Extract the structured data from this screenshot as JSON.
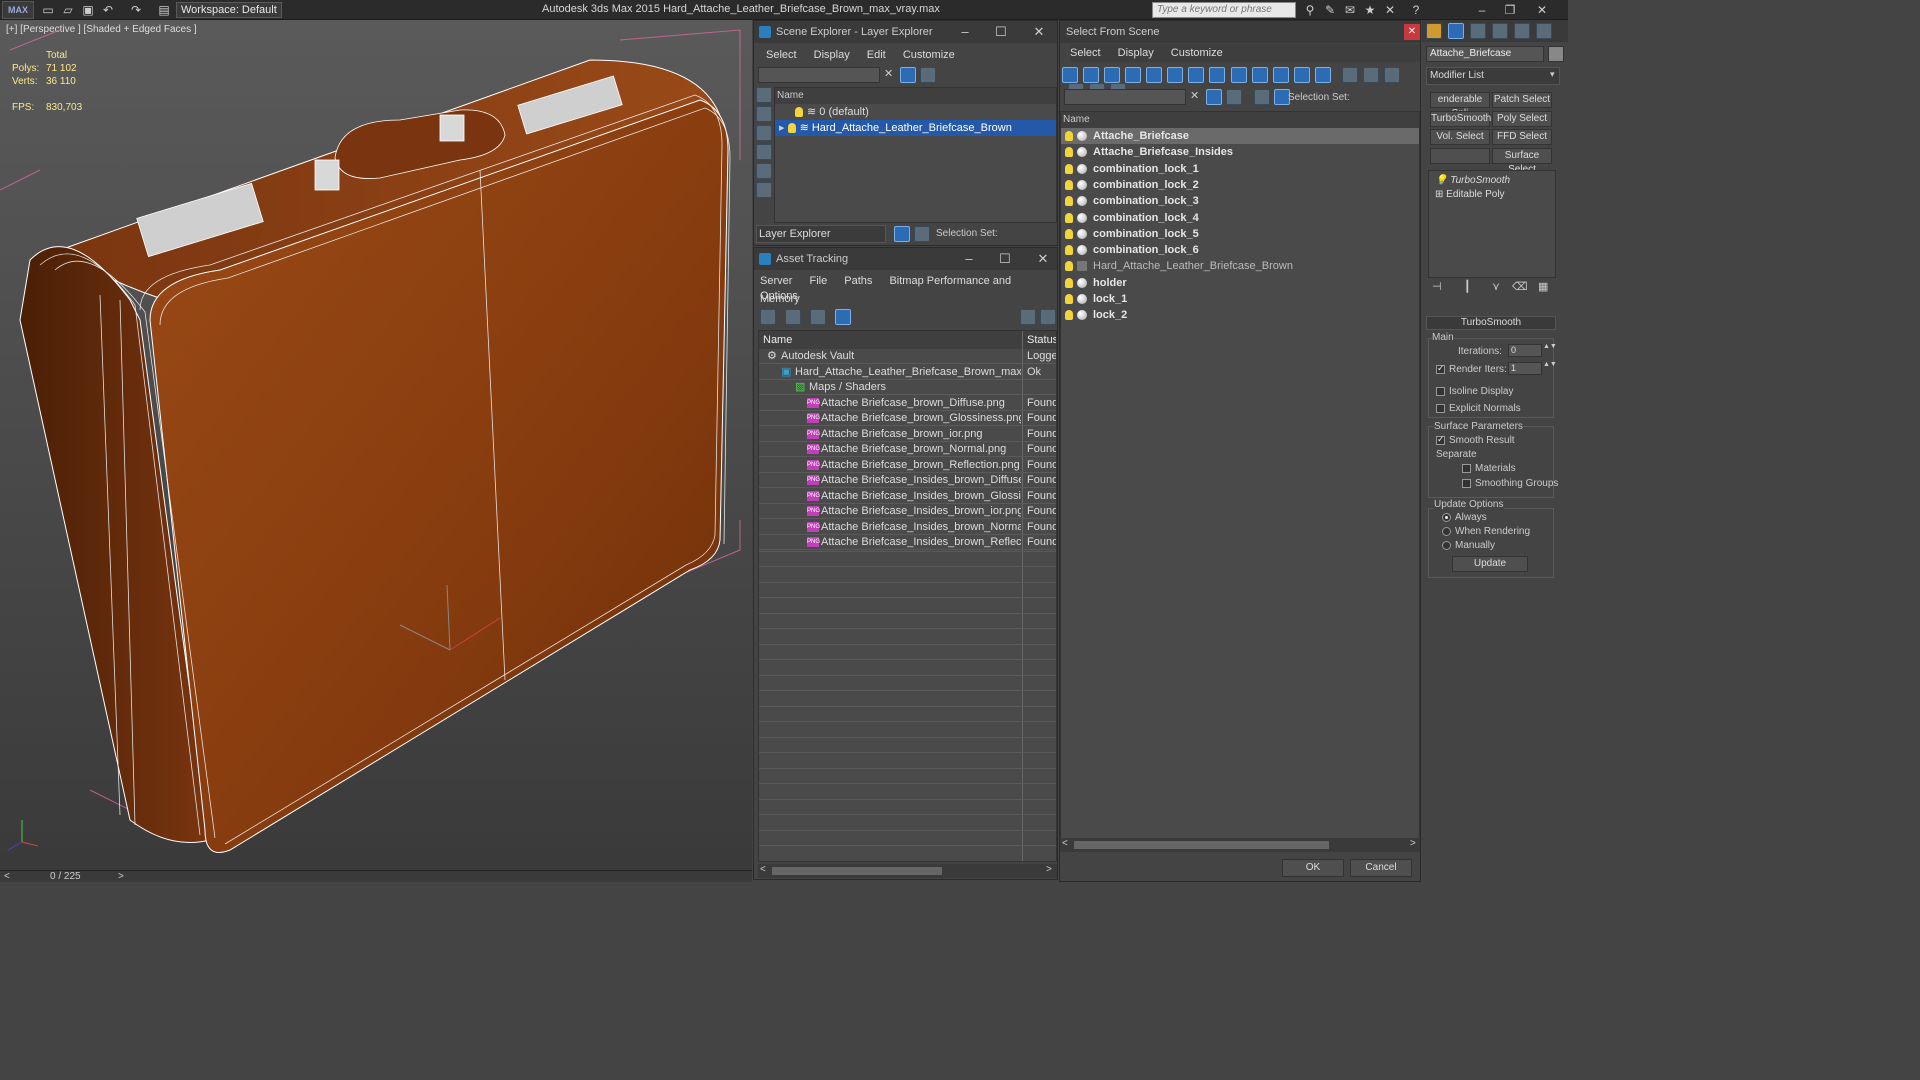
{
  "app": {
    "logo": "MAX",
    "workspace": "Workspace: Default",
    "title": "Autodesk 3ds Max 2015     Hard_Attache_Leather_Briefcase_Brown_max_vray.max",
    "search_placeholder": "Type a keyword or phrase"
  },
  "viewport": {
    "label": "[+] [Perspective ] [Shaded + Edged Faces ]",
    "stats_total": "Total",
    "polys_label": "Polys:",
    "polys_value": "71 102",
    "verts_label": "Verts:",
    "verts_value": "36 110",
    "fps_label": "FPS:",
    "fps_value": "830,703",
    "timeline": "0 / 225"
  },
  "scene_explorer": {
    "title": "Scene Explorer - Layer Explorer",
    "menu": [
      "Select",
      "Display",
      "Edit",
      "Customize"
    ],
    "col_name": "Name",
    "rows": [
      "0 (default)",
      "Hard_Attache_Leather_Briefcase_Brown"
    ],
    "footer_combo": "Layer Explorer",
    "selection_set": "Selection Set:"
  },
  "asset_tracking": {
    "title": "Asset Tracking",
    "menu": [
      "Server",
      "File",
      "Paths",
      "Bitmap Performance and Memory",
      "Options"
    ],
    "col_name": "Name",
    "col_status": "Status",
    "rows": [
      {
        "name": "Autodesk Vault",
        "status": "Logged"
      },
      {
        "name": "Hard_Attache_Leather_Briefcase_Brown_max_vr...",
        "status": "Ok"
      },
      {
        "name": "Maps / Shaders",
        "status": ""
      },
      {
        "name": "Attache Briefcase_brown_Diffuse.png",
        "status": "Found"
      },
      {
        "name": "Attache Briefcase_brown_Glossiness.png",
        "status": "Found"
      },
      {
        "name": "Attache Briefcase_brown_ior.png",
        "status": "Found"
      },
      {
        "name": "Attache Briefcase_brown_Normal.png",
        "status": "Found"
      },
      {
        "name": "Attache Briefcase_brown_Reflection.png",
        "status": "Found"
      },
      {
        "name": "Attache Briefcase_Insides_brown_Diffuse....",
        "status": "Found"
      },
      {
        "name": "Attache Briefcase_Insides_brown_Glossine...",
        "status": "Found"
      },
      {
        "name": "Attache Briefcase_Insides_brown_ior.png",
        "status": "Found"
      },
      {
        "name": "Attache Briefcase_Insides_brown_Normal....",
        "status": "Found"
      },
      {
        "name": "Attache Briefcase_Insides_brown_Reflectio...",
        "status": "Found"
      }
    ]
  },
  "select_from_scene": {
    "title": "Select From Scene",
    "menu": [
      "Select",
      "Display",
      "Customize"
    ],
    "selection_set": "Selection Set:",
    "col_name": "Name",
    "objects": [
      "Attache_Briefcase",
      "Attache_Briefcase_Insides",
      "combination_lock_1",
      "combination_lock_2",
      "combination_lock_3",
      "combination_lock_4",
      "combination_lock_5",
      "combination_lock_6",
      "Hard_Attache_Leather_Briefcase_Brown",
      "holder",
      "lock_1",
      "lock_2"
    ],
    "ok": "OK",
    "cancel": "Cancel"
  },
  "modify_panel": {
    "object_name": "Attache_Briefcase",
    "modifier_list": "Modifier List",
    "buttons": [
      "enderable Spli",
      "Patch Select",
      "TurboSmooth",
      "Poly Select",
      "Vol. Select",
      "FFD Select",
      "",
      "Surface Select"
    ],
    "stack": [
      "TurboSmooth",
      "Editable Poly"
    ],
    "rollout_title": "TurboSmooth",
    "main_label": "Main",
    "iterations_label": "Iterations:",
    "iterations_value": "0",
    "render_iters_label": "Render Iters:",
    "render_iters_value": "1",
    "isoline": "Isoline Display",
    "explicit_normals": "Explicit Normals",
    "surface_params": "Surface Parameters",
    "smooth_result": "Smooth Result",
    "separate": "Separate",
    "materials": "Materials",
    "smoothing_groups": "Smoothing Groups",
    "update_options": "Update Options",
    "always": "Always",
    "when_rendering": "When Rendering",
    "manually": "Manually",
    "update": "Update"
  }
}
